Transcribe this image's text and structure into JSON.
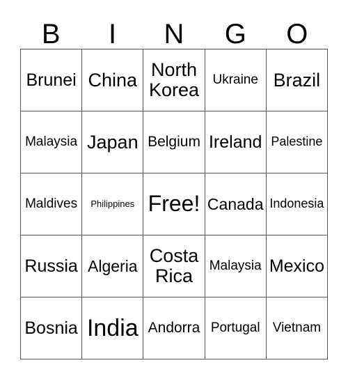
{
  "card": {
    "title": "BINGO",
    "headers": [
      "B",
      "I",
      "N",
      "G",
      "O"
    ],
    "rows": [
      [
        {
          "label": "Brunei",
          "size": "fs-xl"
        },
        {
          "label": "China",
          "size": "fs-2xl"
        },
        {
          "label": "North Korea",
          "size": "fs-2xl"
        },
        {
          "label": "Ukraine",
          "size": "fs-m"
        },
        {
          "label": "Brazil",
          "size": "fs-2xl"
        }
      ],
      [
        {
          "label": "Malaysia",
          "size": "fs-m"
        },
        {
          "label": "Japan",
          "size": "fs-2xl"
        },
        {
          "label": "Belgium",
          "size": "fs-ml"
        },
        {
          "label": "Ireland",
          "size": "fs-xl"
        },
        {
          "label": "Palestine",
          "size": "fs-sm"
        }
      ],
      [
        {
          "label": "Maldives",
          "size": "fs-m"
        },
        {
          "label": "Philippines",
          "size": "fs-xs"
        },
        {
          "label": "Free!",
          "size": "fs-3xl"
        },
        {
          "label": "Canada",
          "size": "fs-l"
        },
        {
          "label": "Indonesia",
          "size": "fs-sm"
        }
      ],
      [
        {
          "label": "Russia",
          "size": "fs-xl"
        },
        {
          "label": "Algeria",
          "size": "fs-l"
        },
        {
          "label": "Costa Rica",
          "size": "fs-2xl"
        },
        {
          "label": "Malaysia",
          "size": "fs-m"
        },
        {
          "label": "Mexico",
          "size": "fs-xl"
        }
      ],
      [
        {
          "label": "Bosnia",
          "size": "fs-xl"
        },
        {
          "label": "India",
          "size": "fs-4xl"
        },
        {
          "label": "Andorra",
          "size": "fs-ml"
        },
        {
          "label": "Portugal",
          "size": "fs-m"
        },
        {
          "label": "Vietnam",
          "size": "fs-m"
        }
      ]
    ],
    "free_space": {
      "row": 2,
      "col": 2,
      "label": "Free!"
    },
    "colors": {
      "background": "#ffffff",
      "text": "#000000",
      "grid_line": "#555555"
    }
  }
}
